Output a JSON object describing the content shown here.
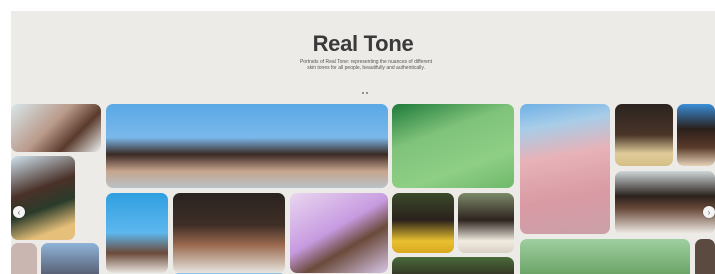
{
  "hero": {
    "title": "Real Tone",
    "subtitle": "Portraits of Real Tone: representing the nuances of different skin tones for all people, beautifully and authentically.",
    "indicator": "••"
  },
  "carousel": {
    "prev_icon": "‹",
    "next_icon": "›"
  },
  "colors": {
    "page_bg": "#ecebe8",
    "title": "#3a3a3a",
    "sky": "#5aa8e6",
    "grass": "#7fc27a"
  }
}
